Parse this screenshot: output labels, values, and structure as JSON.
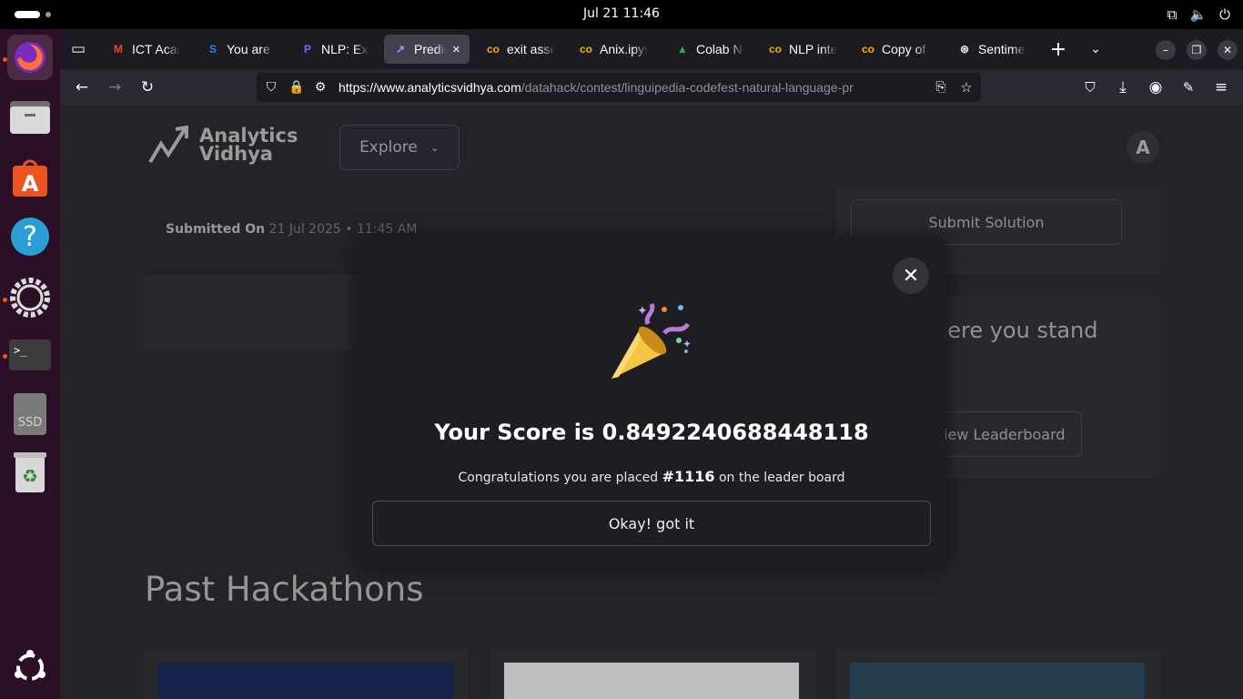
{
  "system": {
    "clock": "Jul 21  11:46",
    "tray_icons": [
      "network-icon",
      "volume-icon",
      "power-icon"
    ]
  },
  "dock": {
    "apps": [
      "firefox-icon",
      "files-icon",
      "app-center-icon",
      "help-icon",
      "settings-icon",
      "terminal-icon",
      "ssd-drive-icon",
      "trash-icon",
      "show-apps-icon"
    ],
    "ssd_label": "SSD"
  },
  "browser": {
    "tabs": [
      {
        "label": "ICT Academy",
        "icon": "gmail-icon",
        "color": "#ea4335",
        "glyph": "M"
      },
      {
        "label": "You are s",
        "icon": "s-icon",
        "color": "#2b7de9",
        "glyph": "S"
      },
      {
        "label": "NLP: Exit",
        "icon": "p-icon",
        "color": "#6b6bff",
        "glyph": "P"
      },
      {
        "label": "Predict",
        "icon": "chart-trend-icon",
        "color": "#9aa0ff",
        "glyph": "↗"
      },
      {
        "label": "exit asse",
        "icon": "colab-icon",
        "color": "#f9ab00",
        "glyph": "co"
      },
      {
        "label": "Anix.ipyn",
        "icon": "colab-icon",
        "color": "#f9ab00",
        "glyph": "co"
      },
      {
        "label": "Colab No",
        "icon": "drive-icon",
        "color": "#34a853",
        "glyph": "▲"
      },
      {
        "label": "NLP inter",
        "icon": "colab-icon",
        "color": "#f9ab00",
        "glyph": "co"
      },
      {
        "label": "Copy of f",
        "icon": "colab-icon",
        "color": "#f9ab00",
        "glyph": "co"
      },
      {
        "label": "Sentimen",
        "icon": "openai-icon",
        "color": "#e0e0e0",
        "glyph": "⊛"
      }
    ],
    "url_host": "https://www.analyticsvidhya.com",
    "url_path": "/datahack/contest/linguipedia-codefest-natural-language-pr"
  },
  "page": {
    "logo_line1": "Analytics",
    "logo_line2": "Vidhya",
    "explore_label": "Explore",
    "avatar_letter": "A",
    "submitted_label": "Submitted On",
    "submitted_value": "21 Jul 2025 • 11:45 AM",
    "submit_solution_label": "Submit Solution",
    "stand_text": "here you stand",
    "view_leaderboard_label": "iew Leaderboard",
    "past_hackathons_title": "Past Hackathons"
  },
  "modal": {
    "score_text": "Your Score is 0.8492240688448118",
    "msg_prefix": "Congratulations you are placed",
    "rank": "#1116",
    "msg_suffix": "on the leader board",
    "ok_label": "Okay! got it"
  }
}
